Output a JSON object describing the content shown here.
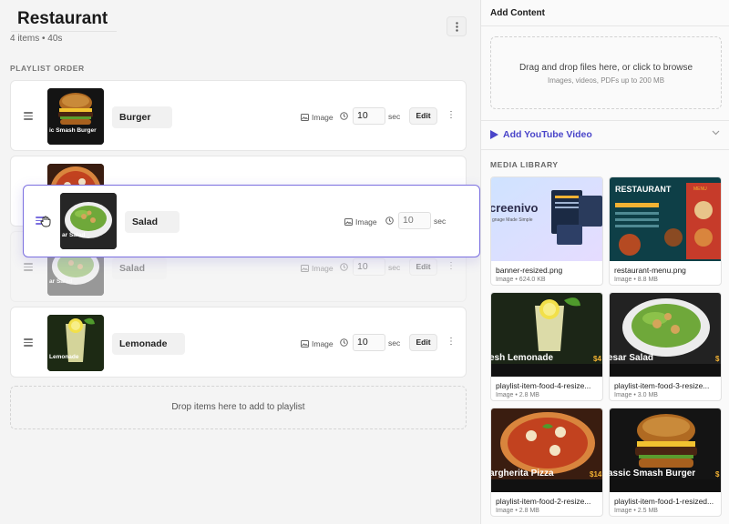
{
  "playlist": {
    "title": "Restaurant",
    "subtitle": "4 items • 40s",
    "section_label": "PLAYLIST ORDER",
    "items": [
      {
        "name": "Burger",
        "type": "Image",
        "duration": "10",
        "unit": "sec",
        "edit_label": "Edit",
        "thumb_caption": "ic Smash Burger"
      },
      {
        "name": "Salad",
        "type": "Image",
        "duration": "10",
        "unit": "sec",
        "edit_label": "Edit",
        "thumb_caption": "ar Salad"
      },
      {
        "name": "Lemonade",
        "type": "Image",
        "duration": "10",
        "unit": "sec",
        "edit_label": "Edit",
        "thumb_caption": "Lemonade"
      }
    ],
    "dragging": {
      "name": "Salad",
      "type": "Image",
      "duration": "10",
      "unit": "sec",
      "thumb_caption": "ar Salad"
    },
    "drop_hint": "Drop items here to add to playlist"
  },
  "add_content": {
    "title": "Add Content",
    "upload_main": "Drag and drop files here, or click to browse",
    "upload_sub": "Images, videos, PDFs up to 200 MB",
    "youtube_label": "Add YouTube Video",
    "library_label": "MEDIA LIBRARY",
    "media": [
      {
        "name": "banner-resized.png",
        "info": "Image • 624.0 KB",
        "img_title": "creenivo",
        "img_sub": "gnage Made Simple"
      },
      {
        "name": "restaurant-menu.png",
        "info": "Image • 8.8 MB",
        "img_title": "RESTAURANT",
        "img_sub": "MENU"
      },
      {
        "name": "playlist-item-food-4-resize...",
        "info": "Image • 2.8 MB",
        "img_title": "esh Lemonade",
        "img_sub": "$4"
      },
      {
        "name": "playlist-item-food-3-resize...",
        "info": "Image • 3.0 MB",
        "img_title": "esar Salad",
        "img_sub": "$"
      },
      {
        "name": "playlist-item-food-2-resize...",
        "info": "Image • 2.8 MB",
        "img_title": "argherita Pizza",
        "img_sub": "$14"
      },
      {
        "name": "playlist-item-food-1-resized...",
        "info": "Image • 2.5 MB",
        "img_title": "assic Smash Burger",
        "img_sub": "$"
      }
    ]
  },
  "colors": {
    "accent": "#4a45c9",
    "drag_border": "#7b6fe0",
    "price": "#f2b233"
  },
  "icons": [
    "drag-handle-icon",
    "image-icon",
    "clock-icon",
    "more-vertical-icon",
    "play-icon",
    "chevron-down-icon",
    "grab-cursor-icon"
  ]
}
